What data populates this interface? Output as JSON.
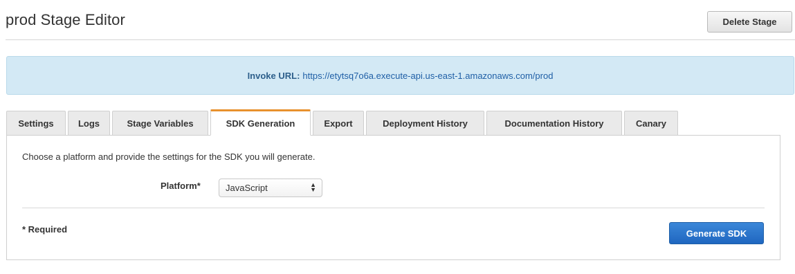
{
  "header": {
    "title": "prod Stage Editor",
    "delete_label": "Delete Stage"
  },
  "invoke": {
    "label": "Invoke URL:",
    "url": "https://etytsq7o6a.execute-api.us-east-1.amazonaws.com/prod"
  },
  "tabs": [
    {
      "label": "Settings",
      "active": false
    },
    {
      "label": "Logs",
      "active": false
    },
    {
      "label": "Stage Variables",
      "active": false
    },
    {
      "label": "SDK Generation",
      "active": true
    },
    {
      "label": "Export",
      "active": false
    },
    {
      "label": "Deployment History",
      "active": false
    },
    {
      "label": "Documentation History",
      "active": false
    },
    {
      "label": "Canary",
      "active": false
    }
  ],
  "sdk": {
    "description": "Choose a platform and provide the settings for the SDK you will generate.",
    "platform_label": "Platform*",
    "platform_value": "JavaScript",
    "required_note": "* Required",
    "generate_label": "Generate SDK"
  },
  "colors": {
    "active_tab_accent": "#e8912d",
    "primary_button": "#1f66c0",
    "invoke_background": "#d3e9f5"
  }
}
